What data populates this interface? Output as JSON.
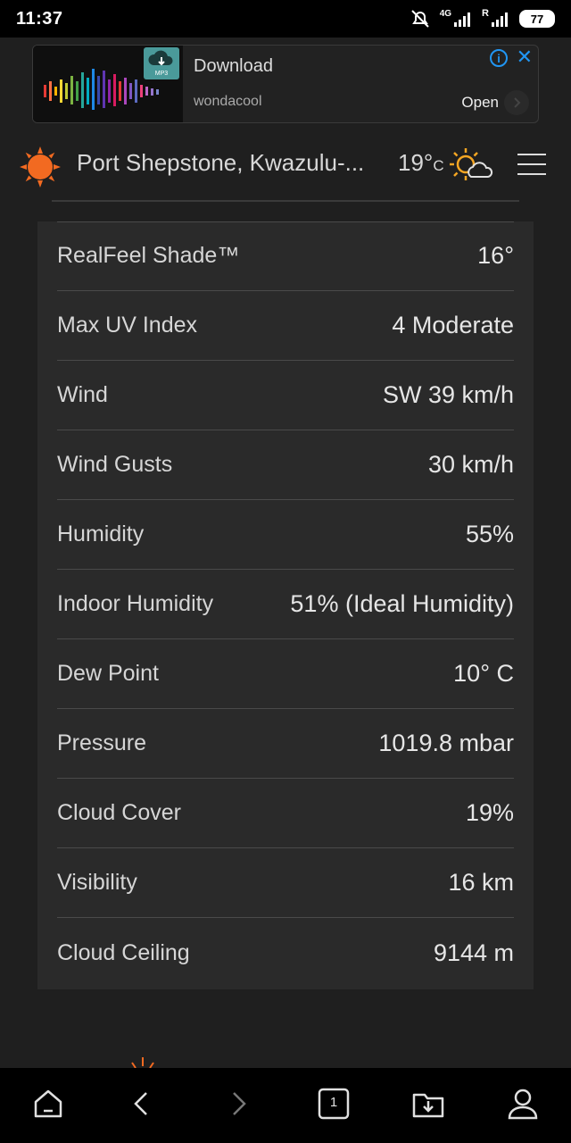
{
  "status_bar": {
    "time": "11:37",
    "network_label": "4G",
    "signal_label": "R",
    "battery": "77"
  },
  "ad": {
    "title": "Download",
    "advertiser": "wondacool",
    "cta": "Open",
    "info_glyph": "i",
    "close_glyph": "✕",
    "app_icon_label": "MP3"
  },
  "header": {
    "location": "Port Shepstone, Kwazulu-...",
    "temperature": "19°",
    "unit": "C",
    "icons": {
      "logo": "sun-logo-icon",
      "weather": "partly-cloudy-icon",
      "menu": "hamburger-menu-icon"
    },
    "accent_color": "#f26a21"
  },
  "details": [
    {
      "label": "RealFeel Shade™",
      "value": "16°"
    },
    {
      "label": "Max UV Index",
      "value": "4 Moderate"
    },
    {
      "label": "Wind",
      "value": "SW 39 km/h"
    },
    {
      "label": "Wind Gusts",
      "value": "30 km/h"
    },
    {
      "label": "Humidity",
      "value": "55%"
    },
    {
      "label": "Indoor Humidity",
      "value": "51% (Ideal Humidity)"
    },
    {
      "label": "Dew Point",
      "value": "10° C"
    },
    {
      "label": "Pressure",
      "value": "1019.8 mbar"
    },
    {
      "label": "Cloud Cover",
      "value": "19%"
    },
    {
      "label": "Visibility",
      "value": "16 km"
    },
    {
      "label": "Cloud Ceiling",
      "value": "9144 m"
    }
  ],
  "browser_nav": {
    "tab_count": "1",
    "icons": [
      "home-icon",
      "back-icon",
      "forward-icon",
      "tabs-icon",
      "downloads-icon",
      "profile-icon"
    ]
  }
}
